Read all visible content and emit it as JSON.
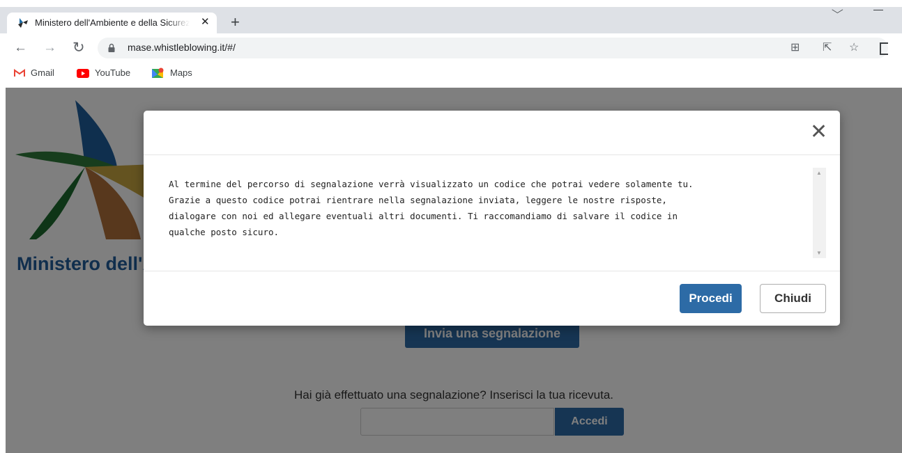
{
  "browser": {
    "tab_title": "Ministero dell'Ambiente e della Sicurezza Energetica",
    "tab_close": "✕",
    "new_tab": "+",
    "url": "mase.whistleblowing.it/#/",
    "bookmarks": [
      {
        "label": "Gmail",
        "icon": "gmail-icon"
      },
      {
        "label": "YouTube",
        "icon": "youtube-icon"
      },
      {
        "label": "Maps",
        "icon": "maps-icon"
      }
    ]
  },
  "page": {
    "title": "Ministero dell'Ambiente e della Sicurezza Energetica",
    "submit_button": "Invia una segnalazione",
    "receipt_prompt": "Hai già effettuato una segnalazione? Inserisci la tua ricevuta.",
    "receipt_input_value": "",
    "access_button": "Accedi"
  },
  "modal": {
    "close_glyph": "✕",
    "body_text": "Al termine del percorso di segnalazione verrà visualizzato un codice che potrai vedere solamente tu.\nGrazie a questo codice potrai rientrare nella segnalazione inviata, leggere le nostre risposte,\ndialogare con noi ed allegare eventuali altri documenti. Ti raccomandiamo di salvare il codice in\nqualche posto sicuro.",
    "primary_button": "Procedi",
    "secondary_button": "Chiudi"
  },
  "colors": {
    "primary": "#2d6ba6",
    "ministry_title": "#205c9a",
    "overlay": "rgba(0,0,0,0.5)"
  }
}
